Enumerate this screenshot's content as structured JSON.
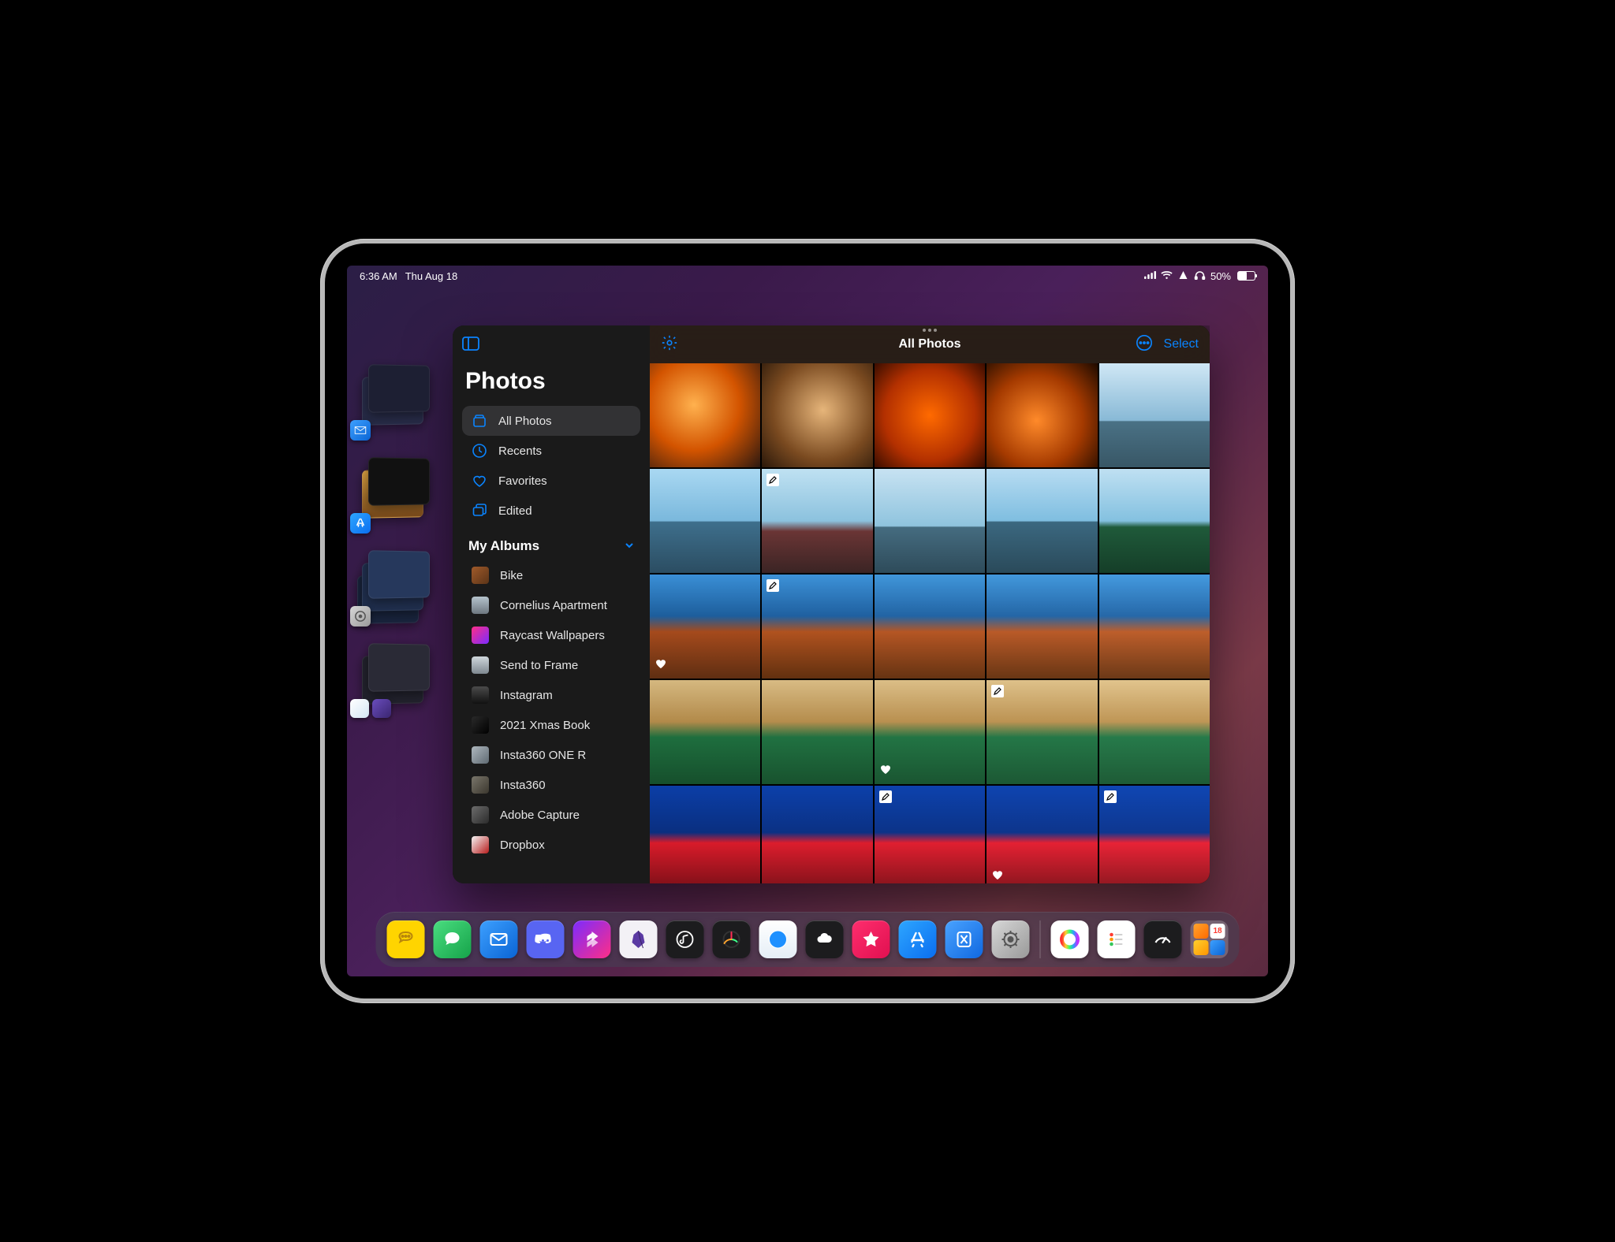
{
  "status": {
    "time": "6:36 AM",
    "date": "Thu Aug 18",
    "battery_percent": "50%"
  },
  "photos": {
    "app_title": "Photos",
    "content_title": "All Photos",
    "select_label": "Select",
    "sidebar_library": [
      {
        "label": "All Photos",
        "icon": "photos-stack"
      },
      {
        "label": "Recents",
        "icon": "clock"
      },
      {
        "label": "Favorites",
        "icon": "heart"
      },
      {
        "label": "Edited",
        "icon": "layers"
      }
    ],
    "albums_header": "My Albums",
    "albums": [
      {
        "label": "Bike",
        "thumb_css": "linear-gradient(135deg,#a05a2a,#5b3418)"
      },
      {
        "label": "Cornelius Apartment",
        "thumb_css": "linear-gradient(180deg,#b5c3cc,#6e7880)"
      },
      {
        "label": "Raycast Wallpapers",
        "thumb_css": "linear-gradient(135deg,#ff2e87,#7b2bff)"
      },
      {
        "label": "Send to Frame",
        "thumb_css": "linear-gradient(180deg,#cfd7dc,#7e8890)"
      },
      {
        "label": "Instagram",
        "thumb_css": "linear-gradient(180deg,#4a4a4a,#111)"
      },
      {
        "label": "2021 Xmas Book",
        "thumb_css": "linear-gradient(135deg,#2a2a2a,#000)"
      },
      {
        "label": "Insta360 ONE R",
        "thumb_css": "linear-gradient(135deg,#afb8bf,#5f6a72)"
      },
      {
        "label": "Insta360",
        "thumb_css": "linear-gradient(135deg,#7a766b,#3b372e)"
      },
      {
        "label": "Adobe Capture",
        "thumb_css": "linear-gradient(135deg,#6c6c6c,#2b2b2b)"
      },
      {
        "label": "Dropbox",
        "thumb_css": "linear-gradient(135deg,#f5f5f5,#b71c1c)"
      }
    ],
    "grid": [
      {
        "bg": "radial-gradient(circle at 40% 40%,#ffb14e,#d35400 50%,#2c1810)",
        "edited": false,
        "fav": false
      },
      {
        "bg": "radial-gradient(circle at 55% 45%,#e6b57a,#7a4a20 60%,#2a180a)",
        "edited": false,
        "fav": false
      },
      {
        "bg": "radial-gradient(circle at 50% 50%,#ff6a00,#b33000 60%,#3a0d00)",
        "edited": false,
        "fav": false
      },
      {
        "bg": "radial-gradient(circle at 45% 55%,#ff8a2a,#a53a00 55%,#1d0a00)",
        "edited": false,
        "fav": false
      },
      {
        "bg": "linear-gradient(180deg,#cfe7f5 0%,#88b9d6 55%,#4a7185 56%,#385766 100%)",
        "edited": false,
        "fav": false
      },
      {
        "bg": "linear-gradient(180deg,#a9d8f2 0%,#7ab8dc 50%,#3e6f8c 51%,#2b4d62 100%)",
        "edited": false,
        "fav": false
      },
      {
        "bg": "linear-gradient(180deg,#bfe1f2 0%,#8cc2de 50%,#6a3535 60%,#3b2424 100%)",
        "edited": true,
        "fav": false
      },
      {
        "bg": "linear-gradient(180deg,#c7e2f2 0%,#8fc4de 55%,#456c80 56%,#2e4b5a 100%)",
        "edited": false,
        "fav": false
      },
      {
        "bg": "linear-gradient(180deg,#b7dcf2 0%,#7fbee0 50%,#3b6880 51%,#2a4a5a 100%)",
        "edited": false,
        "fav": false
      },
      {
        "bg": "linear-gradient(180deg,#bfe0f2 0%,#84c1e0 50%,#1f5a3a 56%,#153e28 100%)",
        "edited": false,
        "fav": false
      },
      {
        "bg": "linear-gradient(180deg,#3a8fd6 0%,#1d5e9c 40%,#a54a1c 55%,#5f2e12 100%)",
        "edited": false,
        "fav": true
      },
      {
        "bg": "linear-gradient(180deg,#3d92d8 0%,#1f60a0 40%,#b0521f 55%,#62300f 100%)",
        "edited": true,
        "fav": false
      },
      {
        "bg": "linear-gradient(180deg,#4096da 0%,#2264a4 40%,#b55624 55%,#663312 100%)",
        "edited": false,
        "fav": false
      },
      {
        "bg": "linear-gradient(180deg,#4298dc 0%,#2466a6 40%,#b95a28 55%,#693614 100%)",
        "edited": false,
        "fav": false
      },
      {
        "bg": "linear-gradient(180deg,#449adf 0%,#2668a8 40%,#bd5e2b 55%,#6c3917 100%)",
        "edited": false,
        "fav": false
      },
      {
        "bg": "linear-gradient(180deg,#d5b880 0%,#b28a4a 40%,#1e6e3e 55%,#164f2c 100%)",
        "edited": false,
        "fav": false
      },
      {
        "bg": "linear-gradient(180deg,#d8bb84 0%,#b58d4d 40%,#207141 55%,#18522e 100%)",
        "edited": false,
        "fav": false
      },
      {
        "bg": "linear-gradient(180deg,#dbbe87 0%,#b99050 40%,#227444 55%,#1a5531 100%)",
        "edited": false,
        "fav": true
      },
      {
        "bg": "linear-gradient(180deg,#dec18a 0%,#bc9353 40%,#247747 55%,#1c5834 100%)",
        "edited": true,
        "fav": false
      },
      {
        "bg": "linear-gradient(180deg,#e1c48d 0%,#bf9656 40%,#267a4a 55%,#1e5b36 100%)",
        "edited": false,
        "fav": false
      },
      {
        "bg": "linear-gradient(180deg,#0b3ea7 0%,#0a2f80 45%,#d81b2a 55%,#7a0f17 100%)",
        "edited": false,
        "fav": false
      },
      {
        "bg": "linear-gradient(180deg,#0c40aa 0%,#0b3184 45%,#dc1d2d 55%,#7e1119 100%)",
        "edited": false,
        "fav": false
      },
      {
        "bg": "linear-gradient(180deg,#0d42ad 0%,#0c3388 45%,#e01f30 55%,#82131b 100%)",
        "edited": true,
        "fav": false
      },
      {
        "bg": "linear-gradient(180deg,#0e44b0 0%,#0d358c 45%,#e42133 55%,#86151d 100%)",
        "edited": false,
        "fav": true
      },
      {
        "bg": "linear-gradient(180deg,#0f46b3 0%,#0e3790 45%,#e82336 55%,#8a171f 100%)",
        "edited": true,
        "fav": false
      }
    ]
  },
  "recent_cluster_date": "18"
}
